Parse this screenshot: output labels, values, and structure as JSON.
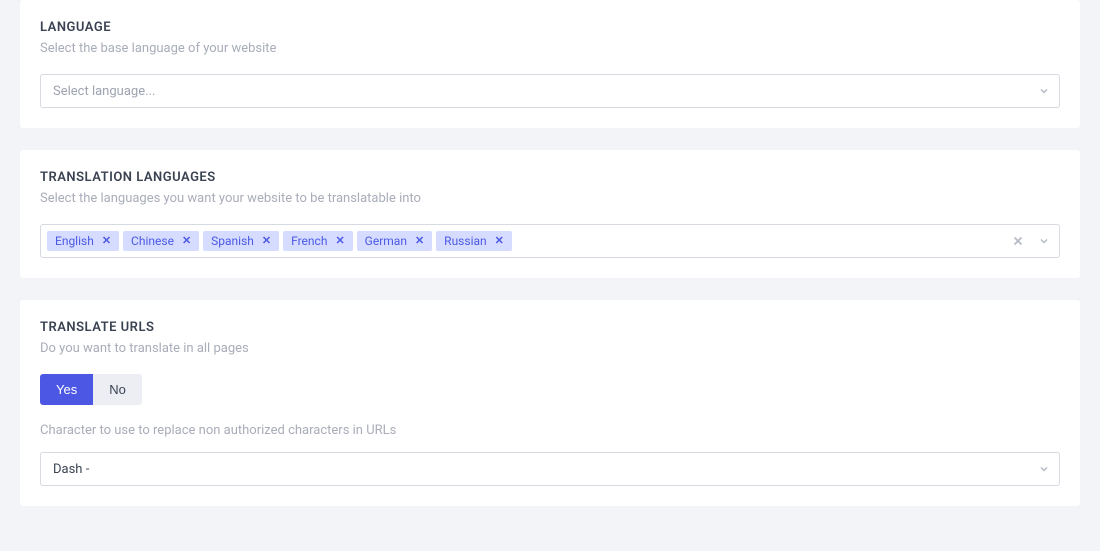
{
  "language": {
    "title": "LANGUAGE",
    "subtitle": "Select the base language of your website",
    "placeholder": "Select language..."
  },
  "translation": {
    "title": "TRANSLATION LANGUAGES",
    "subtitle": "Select the languages you want your website to be translatable into",
    "tags": [
      "English",
      "Chinese",
      "Spanish",
      "French",
      "German",
      "Russian"
    ]
  },
  "urls": {
    "title": "TRANSLATE URLS",
    "subtitle": "Do you want to translate in all pages",
    "yes": "Yes",
    "no": "No",
    "active": "yes",
    "char_label": "Character to use to replace non authorized characters in URLs",
    "char_value": "Dash -"
  }
}
